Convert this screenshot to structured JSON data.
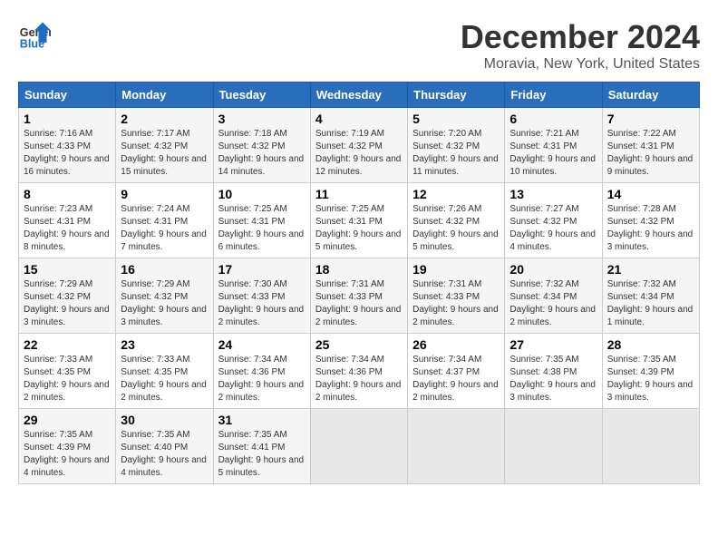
{
  "header": {
    "logo_line1": "General",
    "logo_line2": "Blue",
    "month": "December 2024",
    "location": "Moravia, New York, United States"
  },
  "weekdays": [
    "Sunday",
    "Monday",
    "Tuesday",
    "Wednesday",
    "Thursday",
    "Friday",
    "Saturday"
  ],
  "weeks": [
    [
      {
        "day": 1,
        "sunrise": "7:16 AM",
        "sunset": "4:33 PM",
        "daylight": "9 hours and 16 minutes"
      },
      {
        "day": 2,
        "sunrise": "7:17 AM",
        "sunset": "4:32 PM",
        "daylight": "9 hours and 15 minutes"
      },
      {
        "day": 3,
        "sunrise": "7:18 AM",
        "sunset": "4:32 PM",
        "daylight": "9 hours and 14 minutes"
      },
      {
        "day": 4,
        "sunrise": "7:19 AM",
        "sunset": "4:32 PM",
        "daylight": "9 hours and 12 minutes"
      },
      {
        "day": 5,
        "sunrise": "7:20 AM",
        "sunset": "4:32 PM",
        "daylight": "9 hours and 11 minutes"
      },
      {
        "day": 6,
        "sunrise": "7:21 AM",
        "sunset": "4:31 PM",
        "daylight": "9 hours and 10 minutes"
      },
      {
        "day": 7,
        "sunrise": "7:22 AM",
        "sunset": "4:31 PM",
        "daylight": "9 hours and 9 minutes"
      }
    ],
    [
      {
        "day": 8,
        "sunrise": "7:23 AM",
        "sunset": "4:31 PM",
        "daylight": "9 hours and 8 minutes"
      },
      {
        "day": 9,
        "sunrise": "7:24 AM",
        "sunset": "4:31 PM",
        "daylight": "9 hours and 7 minutes"
      },
      {
        "day": 10,
        "sunrise": "7:25 AM",
        "sunset": "4:31 PM",
        "daylight": "9 hours and 6 minutes"
      },
      {
        "day": 11,
        "sunrise": "7:25 AM",
        "sunset": "4:31 PM",
        "daylight": "9 hours and 5 minutes"
      },
      {
        "day": 12,
        "sunrise": "7:26 AM",
        "sunset": "4:32 PM",
        "daylight": "9 hours and 5 minutes"
      },
      {
        "day": 13,
        "sunrise": "7:27 AM",
        "sunset": "4:32 PM",
        "daylight": "9 hours and 4 minutes"
      },
      {
        "day": 14,
        "sunrise": "7:28 AM",
        "sunset": "4:32 PM",
        "daylight": "9 hours and 3 minutes"
      }
    ],
    [
      {
        "day": 15,
        "sunrise": "7:29 AM",
        "sunset": "4:32 PM",
        "daylight": "9 hours and 3 minutes"
      },
      {
        "day": 16,
        "sunrise": "7:29 AM",
        "sunset": "4:32 PM",
        "daylight": "9 hours and 3 minutes"
      },
      {
        "day": 17,
        "sunrise": "7:30 AM",
        "sunset": "4:33 PM",
        "daylight": "9 hours and 2 minutes"
      },
      {
        "day": 18,
        "sunrise": "7:31 AM",
        "sunset": "4:33 PM",
        "daylight": "9 hours and 2 minutes"
      },
      {
        "day": 19,
        "sunrise": "7:31 AM",
        "sunset": "4:33 PM",
        "daylight": "9 hours and 2 minutes"
      },
      {
        "day": 20,
        "sunrise": "7:32 AM",
        "sunset": "4:34 PM",
        "daylight": "9 hours and 2 minutes"
      },
      {
        "day": 21,
        "sunrise": "7:32 AM",
        "sunset": "4:34 PM",
        "daylight": "9 hours and 1 minute"
      }
    ],
    [
      {
        "day": 22,
        "sunrise": "7:33 AM",
        "sunset": "4:35 PM",
        "daylight": "9 hours and 2 minutes"
      },
      {
        "day": 23,
        "sunrise": "7:33 AM",
        "sunset": "4:35 PM",
        "daylight": "9 hours and 2 minutes"
      },
      {
        "day": 24,
        "sunrise": "7:34 AM",
        "sunset": "4:36 PM",
        "daylight": "9 hours and 2 minutes"
      },
      {
        "day": 25,
        "sunrise": "7:34 AM",
        "sunset": "4:36 PM",
        "daylight": "9 hours and 2 minutes"
      },
      {
        "day": 26,
        "sunrise": "7:34 AM",
        "sunset": "4:37 PM",
        "daylight": "9 hours and 2 minutes"
      },
      {
        "day": 27,
        "sunrise": "7:35 AM",
        "sunset": "4:38 PM",
        "daylight": "9 hours and 3 minutes"
      },
      {
        "day": 28,
        "sunrise": "7:35 AM",
        "sunset": "4:39 PM",
        "daylight": "9 hours and 3 minutes"
      }
    ],
    [
      {
        "day": 29,
        "sunrise": "7:35 AM",
        "sunset": "4:39 PM",
        "daylight": "9 hours and 4 minutes"
      },
      {
        "day": 30,
        "sunrise": "7:35 AM",
        "sunset": "4:40 PM",
        "daylight": "9 hours and 4 minutes"
      },
      {
        "day": 31,
        "sunrise": "7:35 AM",
        "sunset": "4:41 PM",
        "daylight": "9 hours and 5 minutes"
      },
      null,
      null,
      null,
      null
    ]
  ]
}
